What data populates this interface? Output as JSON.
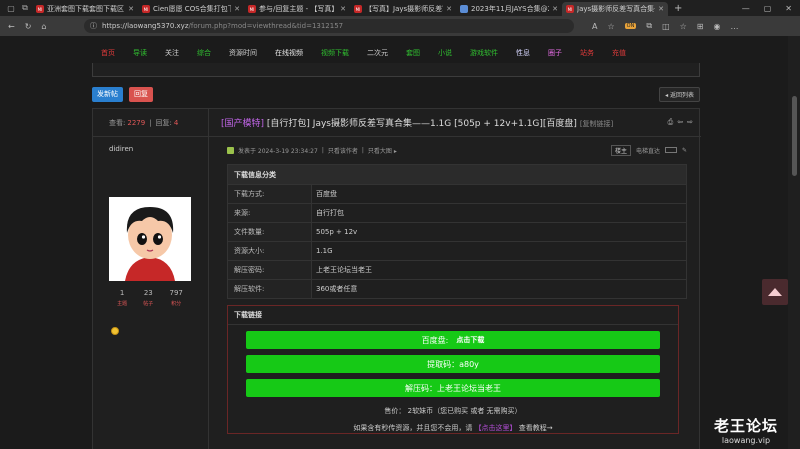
{
  "browser": {
    "tabs": [
      {
        "label": "亚洲套图下载套图下载区",
        "icon": "site-favicon",
        "active": false
      },
      {
        "label": "Cien愿愿 COS合集打包下载",
        "icon": "site-favicon",
        "active": false
      },
      {
        "label": "参与/回复主题 - 【写真】",
        "icon": "site-favicon",
        "active": false
      },
      {
        "label": "【写真】Jays摄影师反差写",
        "icon": "site-favicon",
        "active": false
      },
      {
        "label": "2023年11月JAYS合集@2p",
        "icon": "blue-favicon",
        "active": false
      },
      {
        "label": "Jays摄影师反差写真合集一",
        "icon": "site-favicon",
        "active": true
      }
    ],
    "favicon_text": "MI",
    "newtab_label": "+",
    "url_host": "https://laowang5370.xyz",
    "url_path": "/forum.php?mod=viewthread&tid=1312157",
    "badge": "ON"
  },
  "site": {
    "nav": [
      {
        "label": "首页",
        "color": "#e23b3b"
      },
      {
        "label": "导读",
        "color": "#30c030"
      },
      {
        "label": "关注",
        "color": "#cfcfcf"
      },
      {
        "label": "综合",
        "color": "#30c030"
      },
      {
        "label": "资源时间",
        "color": "#cfcfcf"
      },
      {
        "label": "在线视频",
        "color": "#e8e8e8"
      },
      {
        "label": "视频下载",
        "color": "#30c030"
      },
      {
        "label": "二次元",
        "color": "#cfcfcf"
      },
      {
        "label": "套图",
        "color": "#30c030"
      },
      {
        "label": "小说",
        "color": "#30c030"
      },
      {
        "label": "游戏软件",
        "color": "#30c030"
      },
      {
        "label": "性息",
        "color": "#d7d7ff"
      },
      {
        "label": "圈子",
        "color": "#e06be0"
      },
      {
        "label": "站务",
        "color": "#e23b3b"
      },
      {
        "label": "充值",
        "color": "#e23b3b"
      }
    ],
    "buttons": {
      "post": "发新帖",
      "reply": "回复",
      "back": "◂ 返回列表"
    }
  },
  "thread": {
    "views_label": "查看:",
    "views": "2279",
    "replies_label": "回复:",
    "replies": "4",
    "category": "[国产模特]",
    "title": "[自行打包] Jays摄影师反差写真合集——1.1G [505p + 12v+1.1G][百度盘]",
    "copy_link": "[复制链接]",
    "author": "didiren",
    "user_stats": [
      {
        "value": "1",
        "label": "主题"
      },
      {
        "value": "23",
        "label": "帖子"
      },
      {
        "value": "797",
        "label": "积分"
      }
    ],
    "meta": {
      "posted": "发表于 2024-3-19 23:34:27",
      "only_author": "只看该作者",
      "big_image": "只看大图 ▸",
      "floor": "楼主",
      "mode": "电梯直达"
    },
    "info_table": {
      "caption": "下载信息分类",
      "rows": [
        {
          "k": "下载方式:",
          "v": "百度盘"
        },
        {
          "k": "来源:",
          "v": "自行打包"
        },
        {
          "k": "文件数量:",
          "v": "505p + 12v"
        },
        {
          "k": "资源大小:",
          "v": "1.1G"
        },
        {
          "k": "解压密码:",
          "v": "上老王论坛当老王"
        },
        {
          "k": "解压软件:",
          "v": "360或者任意"
        }
      ]
    },
    "download": {
      "caption": "下载链接",
      "baidu_label": "百度盘:",
      "baidu_action": "点击下载",
      "code": "提取码：a80y",
      "unzip": "解压码：上老王论坛当老王",
      "price": "售价：  2软妹币（您已购买 或者 无需购买）",
      "note_prefix": "如果含有秒传资源，并且您不会用，请 ",
      "note_link": "【点击这里】",
      "note_suffix": " 查看教程→"
    }
  },
  "watermark": {
    "name": "老王论坛",
    "domain": "laowang.vip"
  }
}
